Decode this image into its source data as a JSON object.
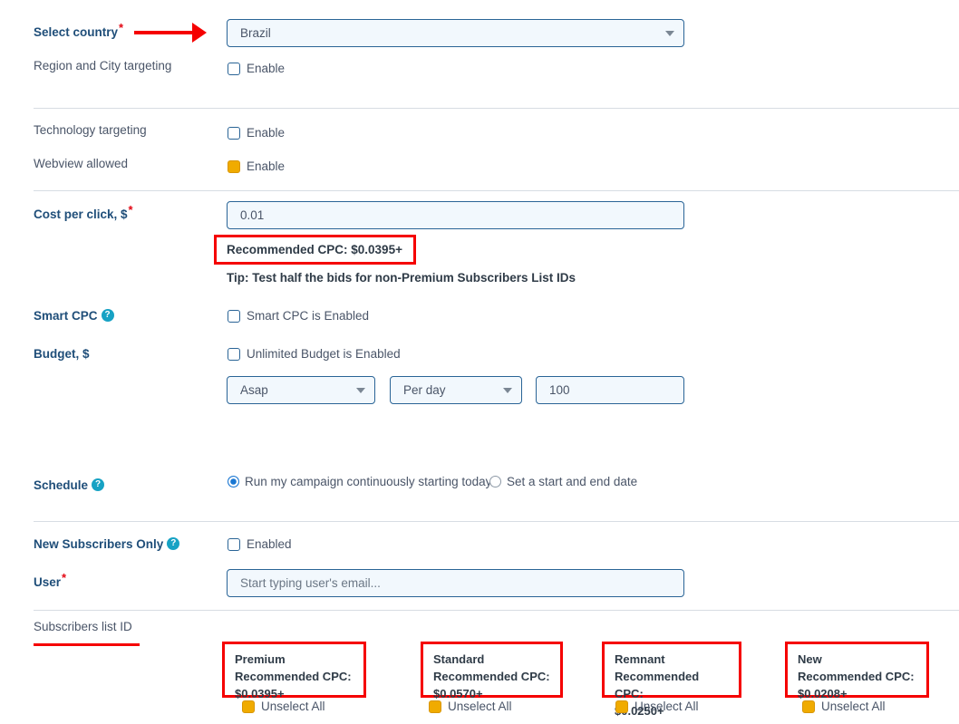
{
  "form": {
    "country": {
      "label": "Select country",
      "required": "*",
      "value": "Brazil"
    },
    "region_city": {
      "label": "Region and City targeting",
      "checkbox_label": "Enable",
      "checked": false
    },
    "technology": {
      "label": "Technology targeting",
      "checkbox_label": "Enable",
      "checked": false
    },
    "webview": {
      "label": "Webview allowed",
      "checkbox_label": "Enable",
      "checked": true
    },
    "cpc": {
      "label": "Cost per click, $",
      "required": "*",
      "value": "0.01",
      "recommended": "Recommended CPC: $0.0395+",
      "tip": "Tip: Test half the bids for non-Premium Subscribers List IDs"
    },
    "smart_cpc": {
      "label": "Smart CPC",
      "help": "?",
      "checkbox_label": "Smart CPC is Enabled",
      "checked": false
    },
    "budget": {
      "label": "Budget, $",
      "unlimited_label": "Unlimited Budget is Enabled",
      "unlimited_checked": false,
      "start_mode": "Asap",
      "period": "Per day",
      "amount": "100"
    },
    "schedule": {
      "label": "Schedule",
      "help": "?",
      "option_continuous": "Run my campaign continuously starting today",
      "option_dates": "Set a start and end date",
      "selected": "continuous"
    },
    "new_subscribers": {
      "label": "New Subscribers Only",
      "help": "?",
      "checkbox_label": "Enabled",
      "checked": false
    },
    "user": {
      "label": "User",
      "required": "*",
      "placeholder": "Start typing user's email...",
      "value": ""
    },
    "subscribers_list": {
      "label": "Subscribers list ID",
      "cards": [
        {
          "title": "Premium",
          "cpc_label": "Recommended CPC:",
          "cpc_value": "$0.0395+",
          "action": "Unselect All",
          "checked": true
        },
        {
          "title": "Standard",
          "cpc_label": "Recommended CPC:",
          "cpc_value": "$0.0570+",
          "action": "Unselect All",
          "checked": true
        },
        {
          "title": "Remnant",
          "cpc_label": "Recommended CPC:",
          "cpc_value": "$0.0250+",
          "action": "Unselect All",
          "checked": true
        },
        {
          "title": "New",
          "cpc_label": "Recommended CPC:",
          "cpc_value": "$0.0208+",
          "action": "Unselect All",
          "checked": true
        }
      ]
    }
  },
  "colors": {
    "annotation_red": "#f50000",
    "label_blue": "#1f4e79",
    "checkbox_on": "#f0ab00",
    "radio_on": "#1976d2",
    "help_badge": "#17a2c4"
  }
}
